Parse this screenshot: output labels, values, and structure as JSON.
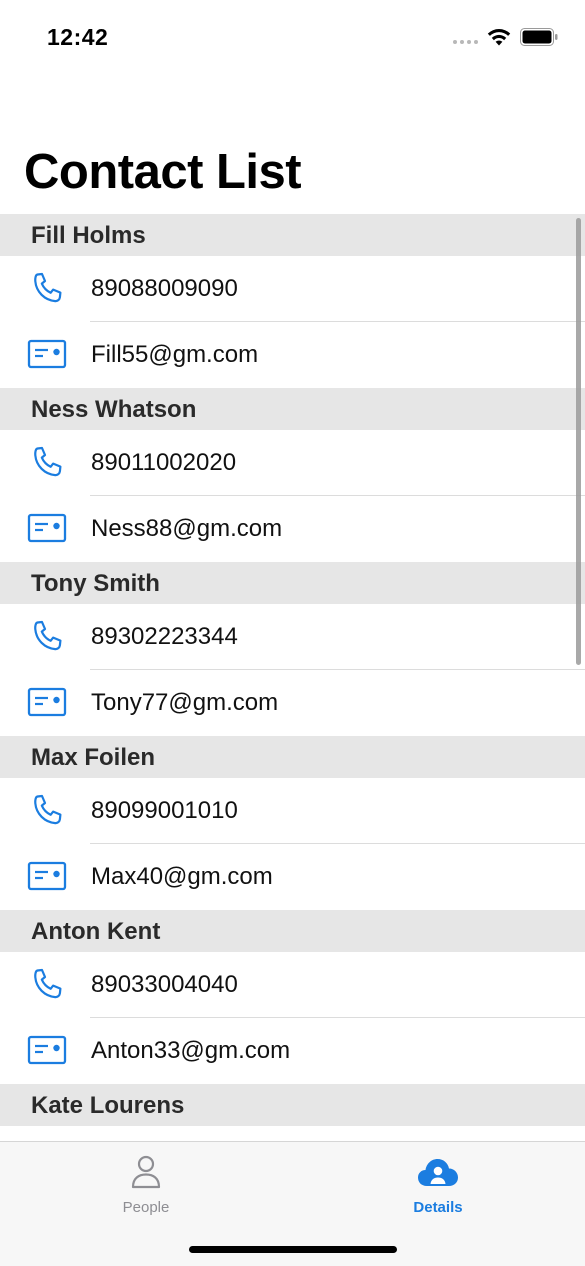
{
  "status_bar": {
    "time": "12:42"
  },
  "header": {
    "title": "Contact List"
  },
  "contacts": [
    {
      "name": "Fill Holms",
      "phone": "89088009090",
      "email": "Fill55@gm.com"
    },
    {
      "name": "Ness Whatson",
      "phone": "89011002020",
      "email": "Ness88@gm.com"
    },
    {
      "name": "Tony Smith",
      "phone": "89302223344",
      "email": "Tony77@gm.com"
    },
    {
      "name": "Max Foilen",
      "phone": "89099001010",
      "email": "Max40@gm.com"
    },
    {
      "name": "Anton Kent",
      "phone": "89033004040",
      "email": "Anton33@gm.com"
    },
    {
      "name": "Kate Lourens",
      "phone": "",
      "email": ""
    }
  ],
  "icons": {
    "phone": "phone-icon",
    "email": "email-card-icon",
    "people_tab": "person-icon",
    "details_tab": "cloud-person-icon"
  },
  "colors": {
    "accent": "#1b7de0",
    "section_header_bg": "#e6e6e6",
    "inactive_tab": "#8e8e93"
  },
  "tab_bar": {
    "tabs": [
      {
        "label": "People",
        "active": false
      },
      {
        "label": "Details",
        "active": true
      }
    ]
  }
}
